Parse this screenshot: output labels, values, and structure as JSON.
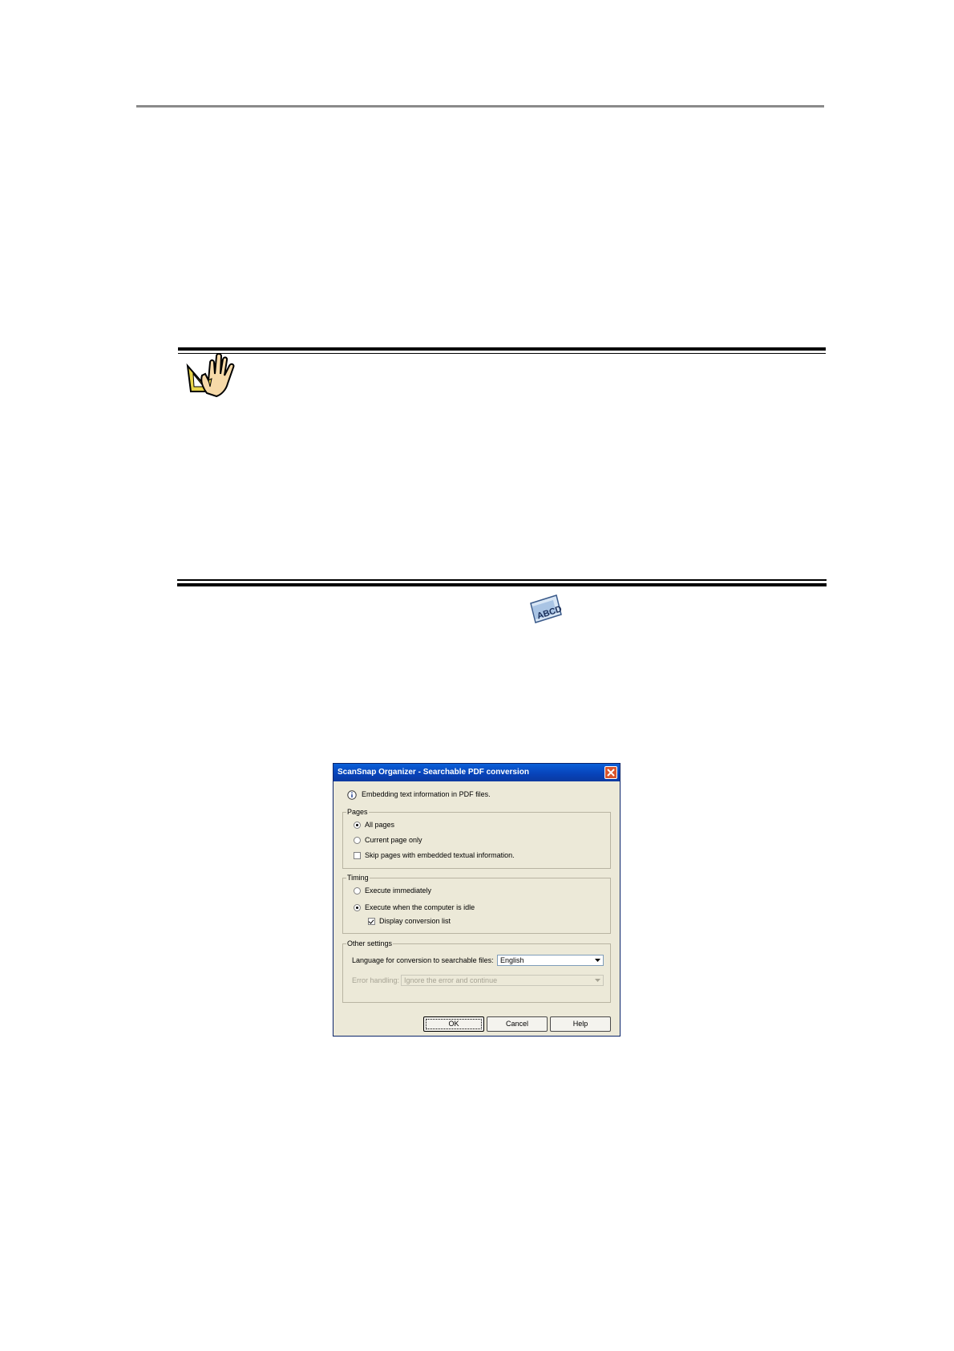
{
  "dialog": {
    "title": "ScanSnap Organizer - Searchable PDF conversion",
    "info": "Embedding text information in PDF files.",
    "pages": {
      "legend": "Pages",
      "all_pages": "All pages",
      "current_page": "Current page only",
      "skip_pages": "Skip pages with embedded textual information.",
      "selected": "all_pages",
      "skip_checked": false
    },
    "timing": {
      "legend": "Timing",
      "immediately": "Execute immediately",
      "when_idle": "Execute when the computer is idle",
      "display_list": "Display conversion list",
      "selected": "when_idle",
      "display_list_checked": true
    },
    "other": {
      "legend": "Other settings",
      "language_label": "Language for conversion to searchable files:",
      "language_value": "English",
      "error_label": "Error handling:",
      "error_value": "Ignore the error and continue"
    },
    "buttons": {
      "ok": "OK",
      "cancel": "Cancel",
      "help": "Help"
    }
  },
  "colors": {
    "titlebar": "#0842b8",
    "dialog_bg": "#ece9d8",
    "close_button": "#d9552c"
  }
}
